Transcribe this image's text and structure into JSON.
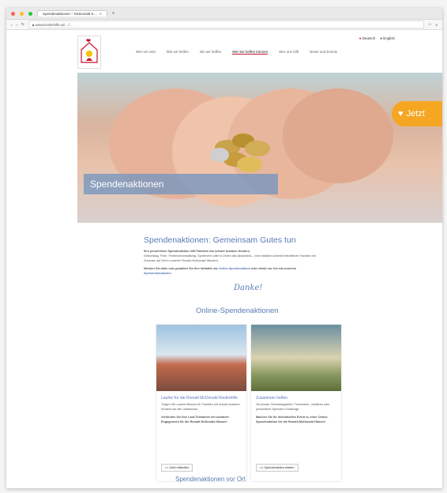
{
  "browser": {
    "tab_title": "Spendenaktionen – McDonald K…",
    "url": "www.kinderhilfe.at/…/…",
    "colors": {
      "accent": "#5a79b6",
      "brand_red": "#c8102e",
      "badge": "#f5a623"
    }
  },
  "nav": {
    "items": [
      "Wer wir sind",
      "Wie wir helfen",
      "Wo wir helfen",
      "Wie Sie helfen können",
      "Wer uns hilft",
      "News und Events"
    ],
    "active_index": 3,
    "lang": [
      "Deutsch",
      "English"
    ]
  },
  "hero": {
    "title": "Spendenaktionen",
    "badge": "Jetzt"
  },
  "intro": {
    "heading": "Spendenaktionen: Gemeinsam Gutes tun",
    "p1": "Ihre persönliche Spendenaktion hilft Familien mit schwer kranken Kindern.",
    "p2": "Geburtstag, Feier, Firmenveranstaltung, Sportevent oder in Zeiten des Abschieds – Ihre Initiative schenkt betroffenen Familien ein Zuhause auf Zeit in unseren Ronald McDonald Häusern.",
    "p3_a": "Werden Sie aktiv und gestalten Sie Ihre Initiative als ",
    "p3_link1": "Online-Spendenaktion",
    "p3_b": " oder direkt vor Ort mit unserem ",
    "p3_link2": "Spendenbaukasten",
    "thanks": "Danke!"
  },
  "online": {
    "heading": "Online-Spendenaktionen",
    "cards": [
      {
        "title": "Laufen für die Ronald McDonald Kinderhilfe",
        "text": "Tragen Sie unsere Mission für Familien mit schwer kranken Kindern auf die Laufstrecke.",
        "bold": "Verbinden Sie Ihre Lauf-Teilnahme mit sozialem Engagement für die Ronald McDonald Häuser!",
        "button": ">> Jetzt mitlaufen"
      },
      {
        "title": "Zusammen helfen",
        "text": "Ob private Geburtstagsfeier, Firmenfeier, Jubiläum oder persönliche Spenden-Challenge:",
        "bold": "Machen Sie Ihr individuelles Event zu einer Online-Spendenaktion für die Ronald McDonald Häuser!",
        "button": ">> Spendenaktion starten"
      }
    ]
  },
  "footer_heading": "Spendenaktionen vor Ort"
}
